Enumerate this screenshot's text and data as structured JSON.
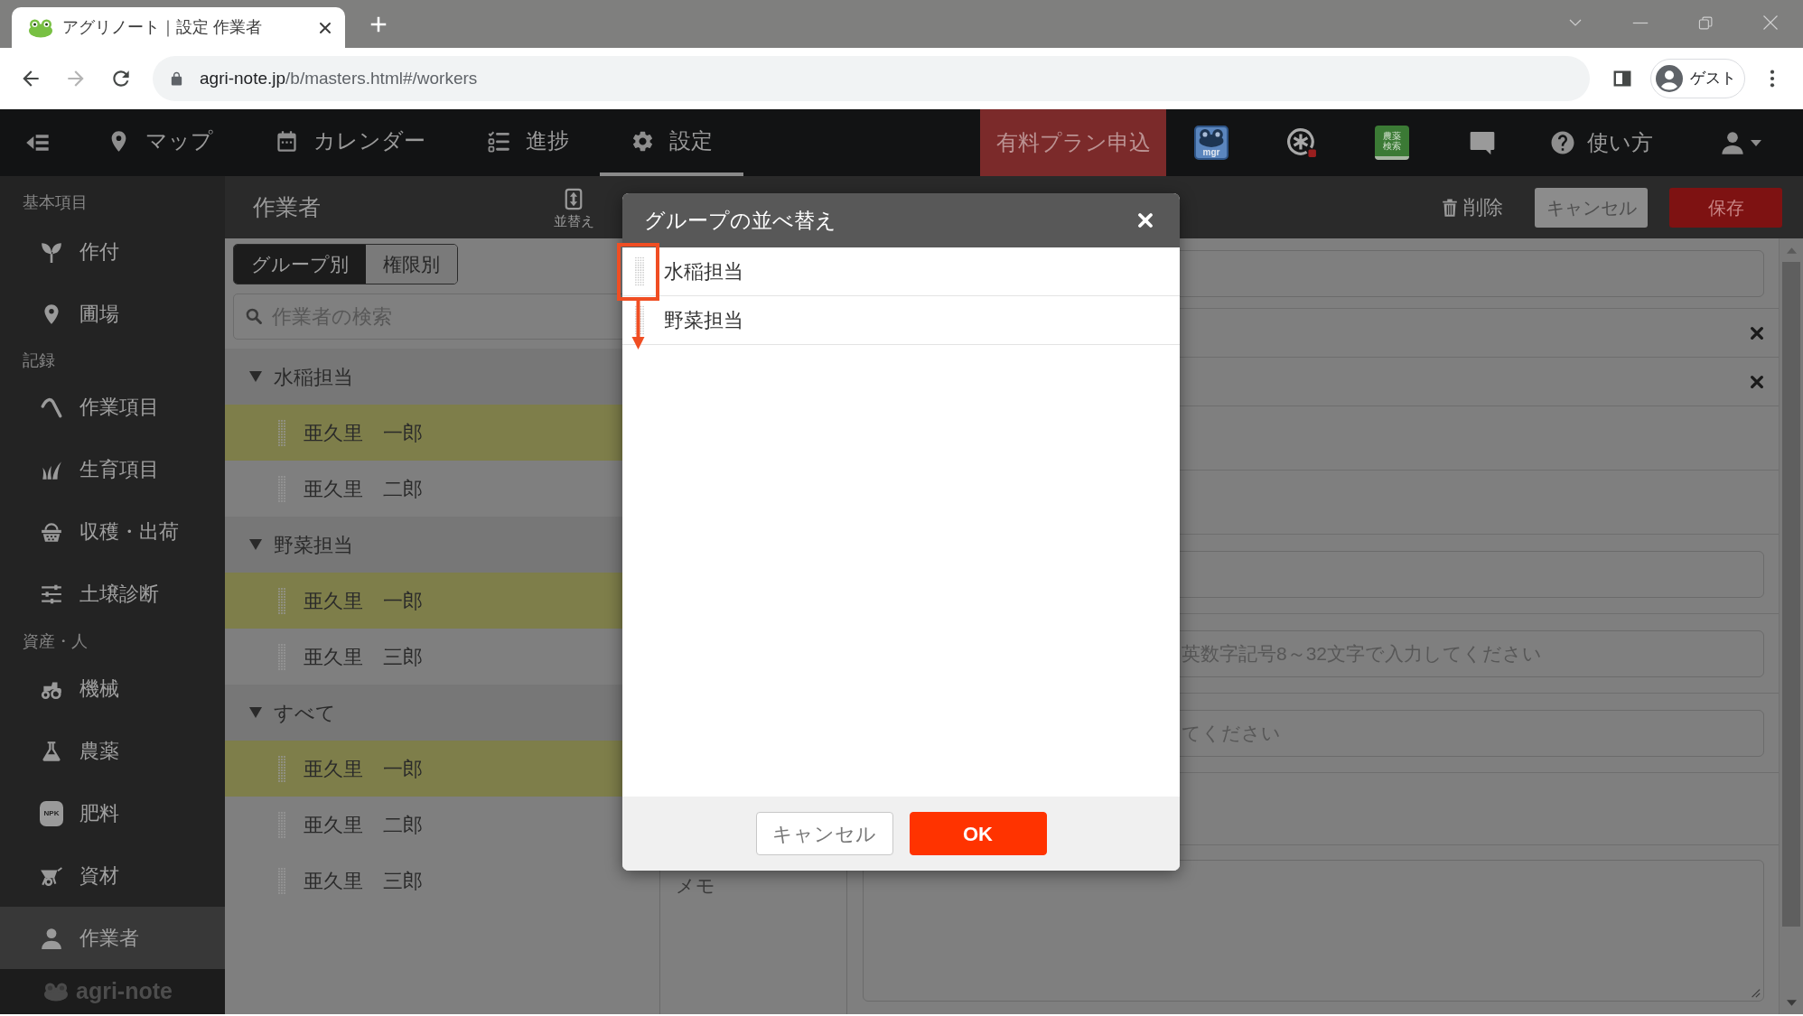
{
  "browser": {
    "tab": {
      "title": "アグリノート｜設定 作業者"
    },
    "url": {
      "host": "agri-note.jp",
      "path": "/b/masters.html#/workers"
    },
    "profile": {
      "label": "ゲスト"
    }
  },
  "nav": {
    "items": [
      {
        "kind": "map",
        "label": "マップ",
        "selected": false
      },
      {
        "kind": "calendar",
        "label": "カレンダー",
        "selected": false
      },
      {
        "kind": "progress",
        "label": "進捗",
        "selected": false
      },
      {
        "kind": "settings",
        "label": "設定",
        "selected": true
      }
    ],
    "upgrade_button": "有料プラン申込",
    "tools": [
      {
        "kind": "frog",
        "label": "mgr"
      },
      {
        "kind": "asterisk"
      },
      {
        "kind": "book",
        "label": "農薬検索"
      },
      {
        "kind": "chat"
      }
    ],
    "help": {
      "label": "使い方"
    }
  },
  "sidebar": {
    "sections": [
      {
        "heading": "基本項目",
        "items": [
          {
            "kind": "sprout",
            "label": "作付",
            "selected": false
          },
          {
            "kind": "pin",
            "label": "圃場",
            "selected": false
          }
        ]
      },
      {
        "heading": "記録",
        "items": [
          {
            "kind": "hoe",
            "label": "作業項目",
            "selected": false
          },
          {
            "kind": "grass",
            "label": "生育項目",
            "selected": false
          },
          {
            "kind": "basket",
            "label": "収穫・出荷",
            "selected": false
          },
          {
            "kind": "sliders",
            "label": "土壌診断",
            "selected": false
          }
        ]
      },
      {
        "heading": "資産・人",
        "items": [
          {
            "kind": "tractor",
            "label": "機械",
            "selected": false
          },
          {
            "kind": "flask",
            "label": "農薬",
            "selected": false
          },
          {
            "kind": "bag",
            "label": "肥料",
            "badge": "NPK",
            "selected": false
          },
          {
            "kind": "wheelbarrow",
            "label": "資材",
            "selected": false
          },
          {
            "kind": "person",
            "label": "作業者",
            "selected": true
          }
        ]
      }
    ],
    "logo": "agri-note"
  },
  "header": {
    "title": "作業者",
    "sort_label": "並替え",
    "delete_label": "削除",
    "cancel_label": "キャンセル",
    "save_label": "保存"
  },
  "list": {
    "toggle": [
      {
        "label": "グループ別",
        "selected": true
      },
      {
        "label": "権限別",
        "selected": false
      }
    ],
    "search": {
      "placeholder": "作業者の検索"
    },
    "groups": [
      {
        "name": "水稲担当",
        "expanded": true,
        "members": [
          {
            "name": "亜久里　一郎",
            "selected": true
          },
          {
            "name": "亜久里　二郎",
            "selected": false
          }
        ]
      },
      {
        "name": "野菜担当",
        "expanded": true,
        "members": [
          {
            "name": "亜久里　一郎",
            "selected": true
          },
          {
            "name": "亜久里　三郎",
            "selected": false
          }
        ]
      },
      {
        "name": "すべて",
        "expanded": true,
        "members": [
          {
            "name": "亜久里　一郎",
            "selected": true
          },
          {
            "name": "亜久里　二郎",
            "selected": false
          },
          {
            "name": "亜久里　三郎",
            "selected": false
          }
        ]
      }
    ]
  },
  "form": {
    "rows": [
      {
        "kind": "input"
      },
      {
        "kind": "removable"
      },
      {
        "kind": "removable"
      },
      {
        "kind": "blank"
      },
      {
        "kind": "blank"
      },
      {
        "kind": "input"
      },
      {
        "kind": "input",
        "placeholder": "英数字記号8～32文字で入力してください"
      },
      {
        "kind": "input",
        "placeholder": "てください"
      },
      {
        "kind": "blank"
      },
      {
        "kind": "textarea",
        "label": "メモ"
      }
    ]
  },
  "dialog": {
    "title": "グループの並べ替え",
    "items": [
      {
        "name": "水稲担当",
        "highlighted": true
      },
      {
        "name": "野菜担当",
        "highlighted": false
      }
    ],
    "buttons": [
      {
        "kind": "secondary",
        "label": "キャンセル"
      },
      {
        "kind": "primary",
        "label": "OK"
      }
    ]
  }
}
